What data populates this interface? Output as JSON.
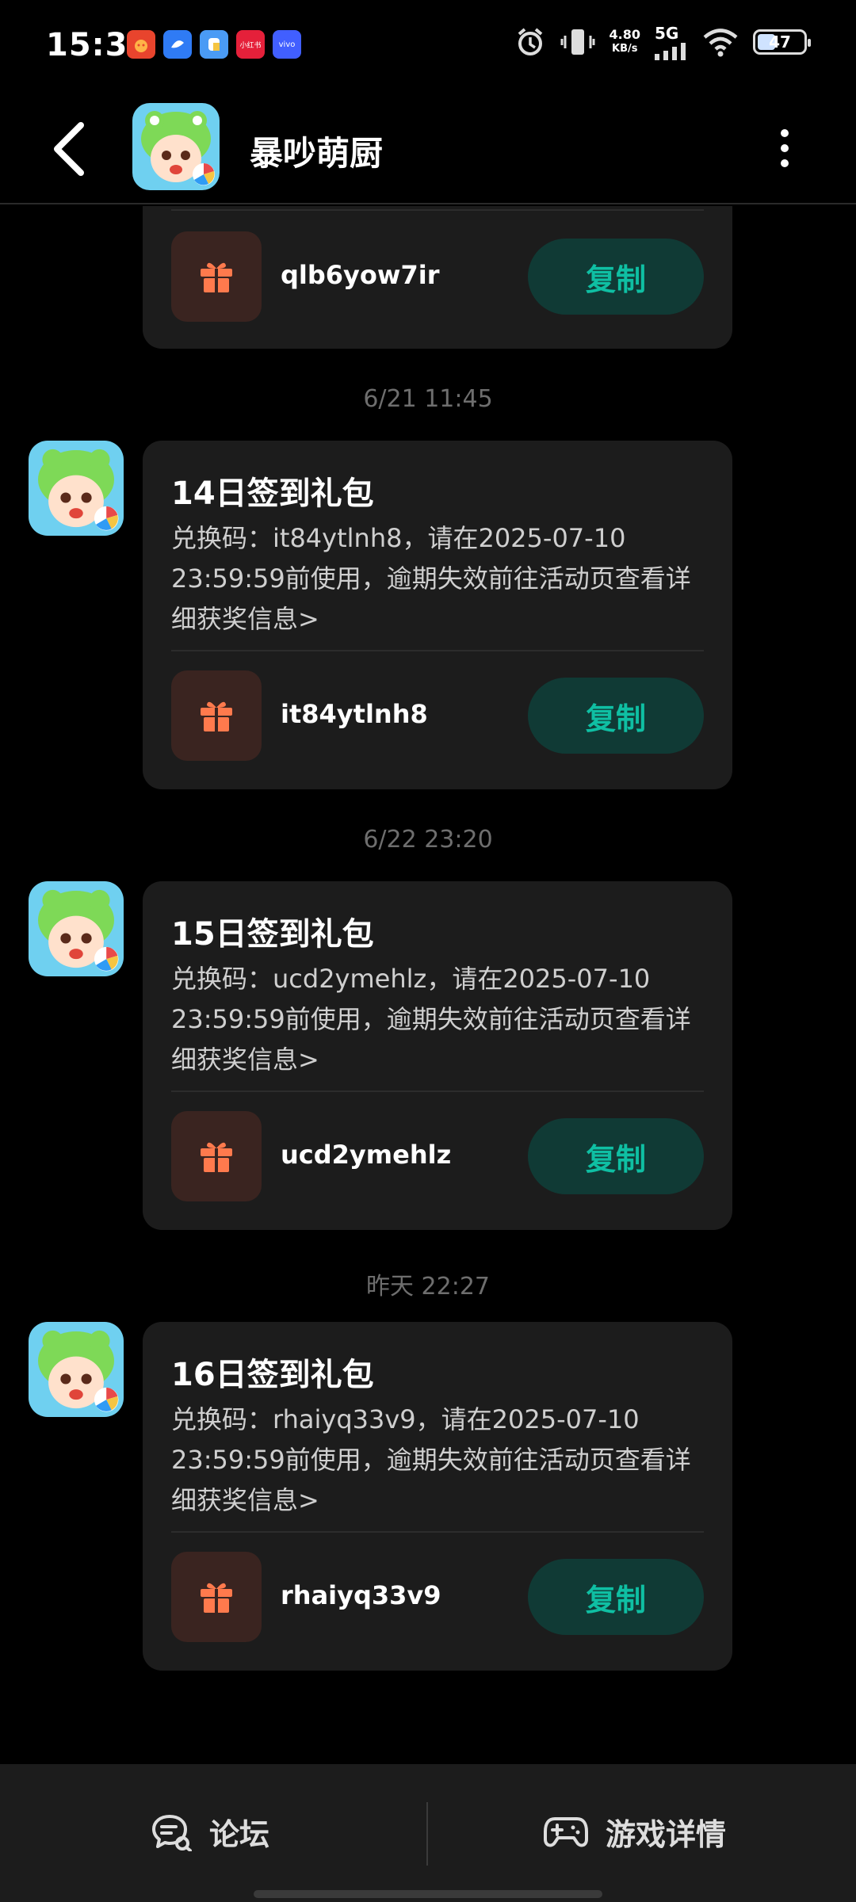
{
  "status_bar": {
    "time": "15:32",
    "net_speed": "4.80",
    "net_unit": "KB/s",
    "network": "5G",
    "battery": "47",
    "mini_app_label": "小红书",
    "vivo_label": "vivo"
  },
  "header": {
    "title": "暴吵萌厨"
  },
  "messages": [
    {
      "code": "qlb6yow7ir",
      "copy_label": "复制"
    },
    {
      "timestamp": "6/21  11:45",
      "title": "14日签到礼包",
      "description": "兑换码：it84ytlnh8，请在2025-07-10 23:59:59前使用，逾期失效前往活动页查看详细获奖信息>",
      "code": "it84ytlnh8",
      "copy_label": "复制"
    },
    {
      "timestamp": "6/22  23:20",
      "title": "15日签到礼包",
      "description": "兑换码：ucd2ymehlz，请在2025-07-10 23:59:59前使用，逾期失效前往活动页查看详细获奖信息>",
      "code": "ucd2ymehlz",
      "copy_label": "复制"
    },
    {
      "timestamp": "昨天  22:27",
      "title": "16日签到礼包",
      "description": "兑换码：rhaiyq33v9，请在2025-07-10 23:59:59前使用，逾期失效前往活动页查看详细获奖信息>",
      "code": "rhaiyq33v9",
      "copy_label": "复制"
    }
  ],
  "bottom_bar": {
    "forum_label": "论坛",
    "game_detail_label": "游戏详情"
  },
  "colors": {
    "card_bg": "#1c1c1c",
    "copy_btn_bg": "#103a35",
    "copy_btn_text": "#0fbfa3",
    "gift_icon": "#ff7a4d"
  }
}
